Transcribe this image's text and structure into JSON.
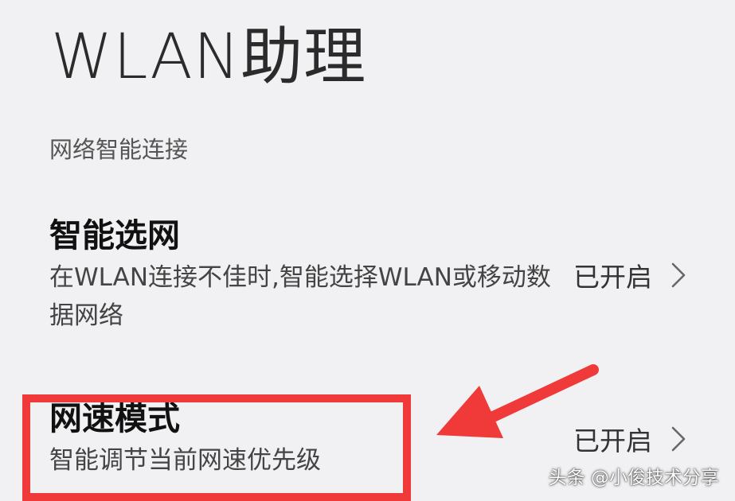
{
  "page": {
    "title": "WLAN助理",
    "section_label": "网络智能连接"
  },
  "settings": [
    {
      "title": "智能选网",
      "description": "在WLAN连接不佳时,智能选择WLAN或移动数据网络",
      "status": "已开启",
      "icon": "chevron-right-icon"
    },
    {
      "title": "网速模式",
      "description": "智能调节当前网速优先级",
      "status": "已开启",
      "icon": "chevron-right-icon"
    }
  ],
  "annotation": {
    "color": "#f03a3a"
  },
  "watermark": {
    "text": "头条 @小俊技术分享"
  },
  "colors": {
    "background": "#f1f1f3",
    "annotation_red": "#f03a3a"
  }
}
